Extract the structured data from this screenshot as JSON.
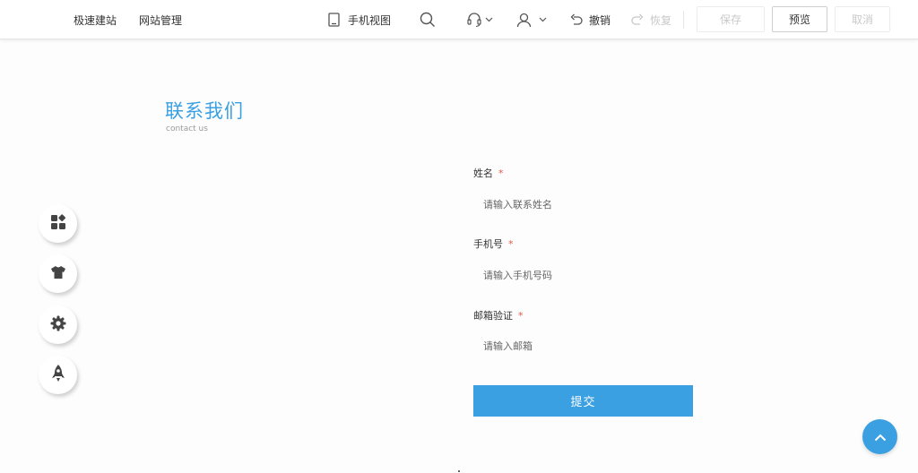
{
  "topbar": {
    "nav": [
      "极速建站",
      "网站管理"
    ],
    "mobile_view_label": "手机视图",
    "undo_label": "撤销",
    "redo_label": "恢复",
    "save_label": "保存",
    "preview_label": "预览",
    "cancel_label": "取消"
  },
  "section": {
    "title": "联系我们",
    "subtitle": "contact us"
  },
  "form": {
    "name_label": "姓名",
    "name_placeholder": "请输入联系姓名",
    "phone_label": "手机号",
    "phone_placeholder": "请输入手机号码",
    "email_label": "邮箱验证",
    "email_placeholder": "请输入邮箱",
    "required_mark": "*",
    "submit_label": "提交"
  },
  "side_tools": [
    "apps-icon",
    "shirt-icon",
    "gear-icon",
    "rocket-icon"
  ],
  "colors": {
    "accent": "#3aa0e2",
    "required": "#e2584d",
    "disabled_text": "#c9c9c9"
  }
}
